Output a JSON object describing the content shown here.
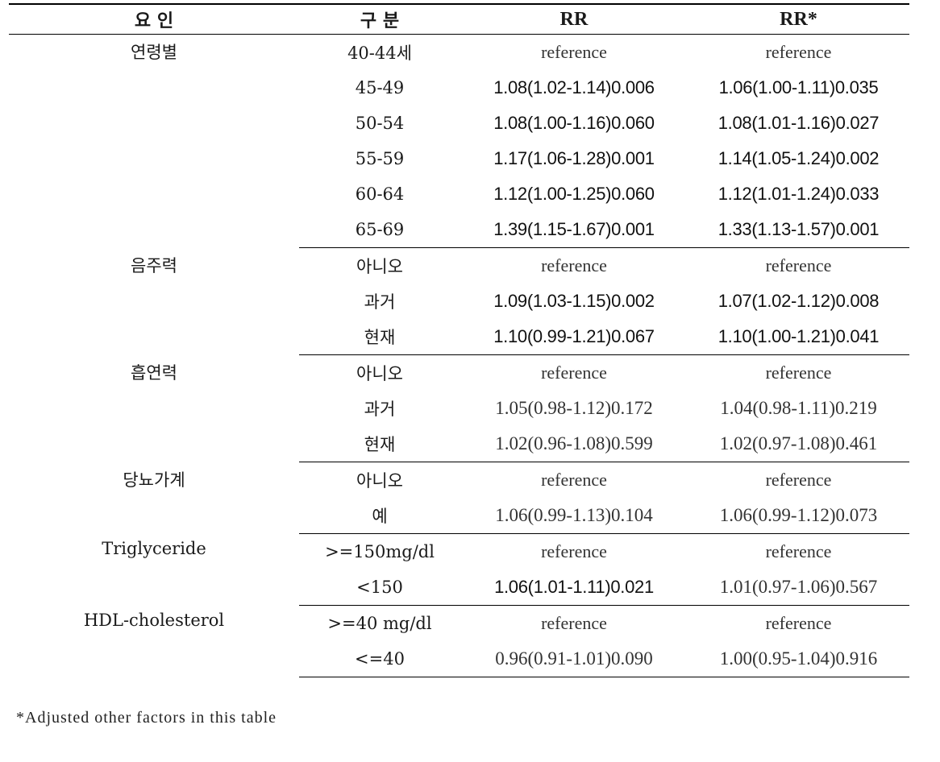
{
  "table": {
    "headers": [
      "요 인",
      "구 분",
      "RR",
      "RR*"
    ],
    "groups": [
      {
        "factor": "연령별",
        "rows": [
          {
            "category": "40-44세",
            "rr": "reference",
            "rr_adj": "reference",
            "rr_bold": false,
            "rr_adj_bold": false
          },
          {
            "category": "45-49",
            "rr": "1.08(1.02-1.14)0.006",
            "rr_adj": "1.06(1.00-1.11)0.035",
            "rr_bold": true,
            "rr_adj_bold": true
          },
          {
            "category": "50-54",
            "rr": "1.08(1.00-1.16)0.060",
            "rr_adj": "1.08(1.01-1.16)0.027",
            "rr_bold": true,
            "rr_adj_bold": true
          },
          {
            "category": "55-59",
            "rr": "1.17(1.06-1.28)0.001",
            "rr_adj": "1.14(1.05-1.24)0.002",
            "rr_bold": true,
            "rr_adj_bold": true
          },
          {
            "category": "60-64",
            "rr": "1.12(1.00-1.25)0.060",
            "rr_adj": "1.12(1.01-1.24)0.033",
            "rr_bold": true,
            "rr_adj_bold": true
          },
          {
            "category": "65-69",
            "rr": "1.39(1.15-1.67)0.001",
            "rr_adj": "1.33(1.13-1.57)0.001",
            "rr_bold": true,
            "rr_adj_bold": true
          }
        ]
      },
      {
        "factor": "음주력",
        "rows": [
          {
            "category": "아니오",
            "rr": "reference",
            "rr_adj": "reference",
            "rr_bold": false,
            "rr_adj_bold": false
          },
          {
            "category": "과거",
            "rr": "1.09(1.03-1.15)0.002",
            "rr_adj": "1.07(1.02-1.12)0.008",
            "rr_bold": true,
            "rr_adj_bold": true
          },
          {
            "category": "현재",
            "rr": "1.10(0.99-1.21)0.067",
            "rr_adj": "1.10(1.00-1.21)0.041",
            "rr_bold": true,
            "rr_adj_bold": true
          }
        ]
      },
      {
        "factor": "흡연력",
        "rows": [
          {
            "category": "아니오",
            "rr": "reference",
            "rr_adj": "reference",
            "rr_bold": false,
            "rr_adj_bold": false
          },
          {
            "category": "과거",
            "rr": "1.05(0.98-1.12)0.172",
            "rr_adj": "1.04(0.98-1.11)0.219",
            "rr_bold": false,
            "rr_adj_bold": false
          },
          {
            "category": "현재",
            "rr": "1.02(0.96-1.08)0.599",
            "rr_adj": "1.02(0.97-1.08)0.461",
            "rr_bold": false,
            "rr_adj_bold": false
          }
        ]
      },
      {
        "factor": "당뇨가계",
        "rows": [
          {
            "category": "아니오",
            "rr": "reference",
            "rr_adj": "reference",
            "rr_bold": false,
            "rr_adj_bold": false
          },
          {
            "category": "예",
            "rr": "1.06(0.99-1.13)0.104",
            "rr_adj": "1.06(0.99-1.12)0.073",
            "rr_bold": false,
            "rr_adj_bold": false
          }
        ]
      },
      {
        "factor": "Triglyceride",
        "rows": [
          {
            "category": ">=150mg/dl",
            "rr": "reference",
            "rr_adj": "reference",
            "rr_bold": false,
            "rr_adj_bold": false
          },
          {
            "category": "<150",
            "rr": "1.06(1.01-1.11)0.021",
            "rr_adj": "1.01(0.97-1.06)0.567",
            "rr_bold": true,
            "rr_adj_bold": false
          }
        ]
      },
      {
        "factor": "HDL-cholesterol",
        "rows": [
          {
            "category": ">=40 mg/dl",
            "rr": "reference",
            "rr_adj": "reference",
            "rr_bold": false,
            "rr_adj_bold": false
          },
          {
            "category": "<=40",
            "rr": "0.96(0.91-1.01)0.090",
            "rr_adj": "1.00(0.95-1.04)0.916",
            "rr_bold": false,
            "rr_adj_bold": false
          }
        ]
      }
    ]
  },
  "footnote": "*Adjusted other factors in this table"
}
